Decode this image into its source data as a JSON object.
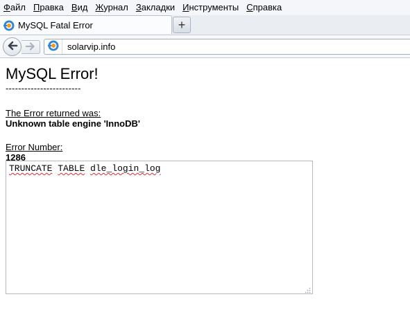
{
  "menu": {
    "items": [
      {
        "accel": "Ф",
        "rest": "айл"
      },
      {
        "accel": "П",
        "rest": "равка"
      },
      {
        "accel": "В",
        "rest": "ид"
      },
      {
        "accel": "Ж",
        "rest": "урнал"
      },
      {
        "accel": "З",
        "rest": "акладки"
      },
      {
        "accel": "И",
        "rest": "нструменты"
      },
      {
        "accel": "С",
        "rest": "правка"
      }
    ]
  },
  "tabs": {
    "active_title": "MySQL Fatal Error",
    "new_tab_symbol": "+"
  },
  "navbar": {
    "url": "solarvip.info"
  },
  "page": {
    "heading": "MySQL Error!",
    "separator": "------------------------",
    "error_label": "The Error returned was:",
    "error_value": "Unknown table engine 'InnoDB'",
    "number_label": "Error Number:",
    "number_value": "1286",
    "sql_words": [
      "TRUNCATE",
      "TABLE",
      "dle_login_log"
    ]
  },
  "colors": {
    "favicon_blue": "#2f86d6",
    "favicon_orange": "#f39a1e",
    "spellcheck_red": "#e0262e"
  }
}
